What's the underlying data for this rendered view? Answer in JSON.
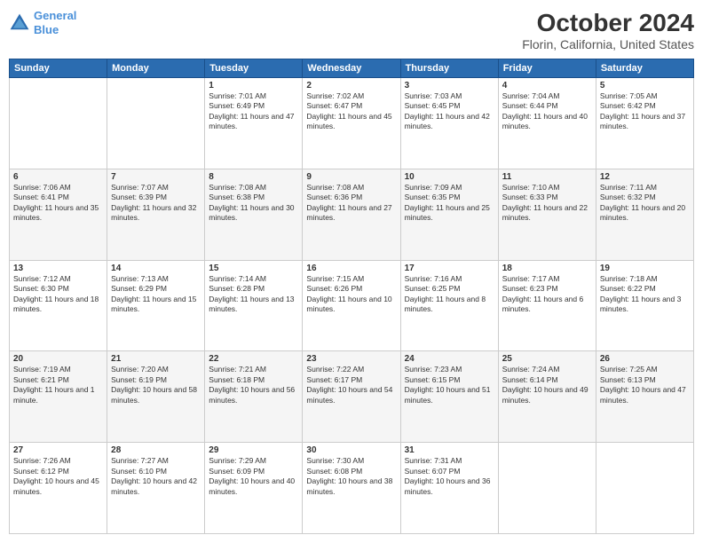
{
  "header": {
    "logo_line1": "General",
    "logo_line2": "Blue",
    "title": "October 2024",
    "subtitle": "Florin, California, United States"
  },
  "days_of_week": [
    "Sunday",
    "Monday",
    "Tuesday",
    "Wednesday",
    "Thursday",
    "Friday",
    "Saturday"
  ],
  "weeks": [
    [
      {
        "day": "",
        "info": ""
      },
      {
        "day": "",
        "info": ""
      },
      {
        "day": "1",
        "info": "Sunrise: 7:01 AM\nSunset: 6:49 PM\nDaylight: 11 hours and 47 minutes."
      },
      {
        "day": "2",
        "info": "Sunrise: 7:02 AM\nSunset: 6:47 PM\nDaylight: 11 hours and 45 minutes."
      },
      {
        "day": "3",
        "info": "Sunrise: 7:03 AM\nSunset: 6:45 PM\nDaylight: 11 hours and 42 minutes."
      },
      {
        "day": "4",
        "info": "Sunrise: 7:04 AM\nSunset: 6:44 PM\nDaylight: 11 hours and 40 minutes."
      },
      {
        "day": "5",
        "info": "Sunrise: 7:05 AM\nSunset: 6:42 PM\nDaylight: 11 hours and 37 minutes."
      }
    ],
    [
      {
        "day": "6",
        "info": "Sunrise: 7:06 AM\nSunset: 6:41 PM\nDaylight: 11 hours and 35 minutes."
      },
      {
        "day": "7",
        "info": "Sunrise: 7:07 AM\nSunset: 6:39 PM\nDaylight: 11 hours and 32 minutes."
      },
      {
        "day": "8",
        "info": "Sunrise: 7:08 AM\nSunset: 6:38 PM\nDaylight: 11 hours and 30 minutes."
      },
      {
        "day": "9",
        "info": "Sunrise: 7:08 AM\nSunset: 6:36 PM\nDaylight: 11 hours and 27 minutes."
      },
      {
        "day": "10",
        "info": "Sunrise: 7:09 AM\nSunset: 6:35 PM\nDaylight: 11 hours and 25 minutes."
      },
      {
        "day": "11",
        "info": "Sunrise: 7:10 AM\nSunset: 6:33 PM\nDaylight: 11 hours and 22 minutes."
      },
      {
        "day": "12",
        "info": "Sunrise: 7:11 AM\nSunset: 6:32 PM\nDaylight: 11 hours and 20 minutes."
      }
    ],
    [
      {
        "day": "13",
        "info": "Sunrise: 7:12 AM\nSunset: 6:30 PM\nDaylight: 11 hours and 18 minutes."
      },
      {
        "day": "14",
        "info": "Sunrise: 7:13 AM\nSunset: 6:29 PM\nDaylight: 11 hours and 15 minutes."
      },
      {
        "day": "15",
        "info": "Sunrise: 7:14 AM\nSunset: 6:28 PM\nDaylight: 11 hours and 13 minutes."
      },
      {
        "day": "16",
        "info": "Sunrise: 7:15 AM\nSunset: 6:26 PM\nDaylight: 11 hours and 10 minutes."
      },
      {
        "day": "17",
        "info": "Sunrise: 7:16 AM\nSunset: 6:25 PM\nDaylight: 11 hours and 8 minutes."
      },
      {
        "day": "18",
        "info": "Sunrise: 7:17 AM\nSunset: 6:23 PM\nDaylight: 11 hours and 6 minutes."
      },
      {
        "day": "19",
        "info": "Sunrise: 7:18 AM\nSunset: 6:22 PM\nDaylight: 11 hours and 3 minutes."
      }
    ],
    [
      {
        "day": "20",
        "info": "Sunrise: 7:19 AM\nSunset: 6:21 PM\nDaylight: 11 hours and 1 minute."
      },
      {
        "day": "21",
        "info": "Sunrise: 7:20 AM\nSunset: 6:19 PM\nDaylight: 10 hours and 58 minutes."
      },
      {
        "day": "22",
        "info": "Sunrise: 7:21 AM\nSunset: 6:18 PM\nDaylight: 10 hours and 56 minutes."
      },
      {
        "day": "23",
        "info": "Sunrise: 7:22 AM\nSunset: 6:17 PM\nDaylight: 10 hours and 54 minutes."
      },
      {
        "day": "24",
        "info": "Sunrise: 7:23 AM\nSunset: 6:15 PM\nDaylight: 10 hours and 51 minutes."
      },
      {
        "day": "25",
        "info": "Sunrise: 7:24 AM\nSunset: 6:14 PM\nDaylight: 10 hours and 49 minutes."
      },
      {
        "day": "26",
        "info": "Sunrise: 7:25 AM\nSunset: 6:13 PM\nDaylight: 10 hours and 47 minutes."
      }
    ],
    [
      {
        "day": "27",
        "info": "Sunrise: 7:26 AM\nSunset: 6:12 PM\nDaylight: 10 hours and 45 minutes."
      },
      {
        "day": "28",
        "info": "Sunrise: 7:27 AM\nSunset: 6:10 PM\nDaylight: 10 hours and 42 minutes."
      },
      {
        "day": "29",
        "info": "Sunrise: 7:29 AM\nSunset: 6:09 PM\nDaylight: 10 hours and 40 minutes."
      },
      {
        "day": "30",
        "info": "Sunrise: 7:30 AM\nSunset: 6:08 PM\nDaylight: 10 hours and 38 minutes."
      },
      {
        "day": "31",
        "info": "Sunrise: 7:31 AM\nSunset: 6:07 PM\nDaylight: 10 hours and 36 minutes."
      },
      {
        "day": "",
        "info": ""
      },
      {
        "day": "",
        "info": ""
      }
    ]
  ]
}
